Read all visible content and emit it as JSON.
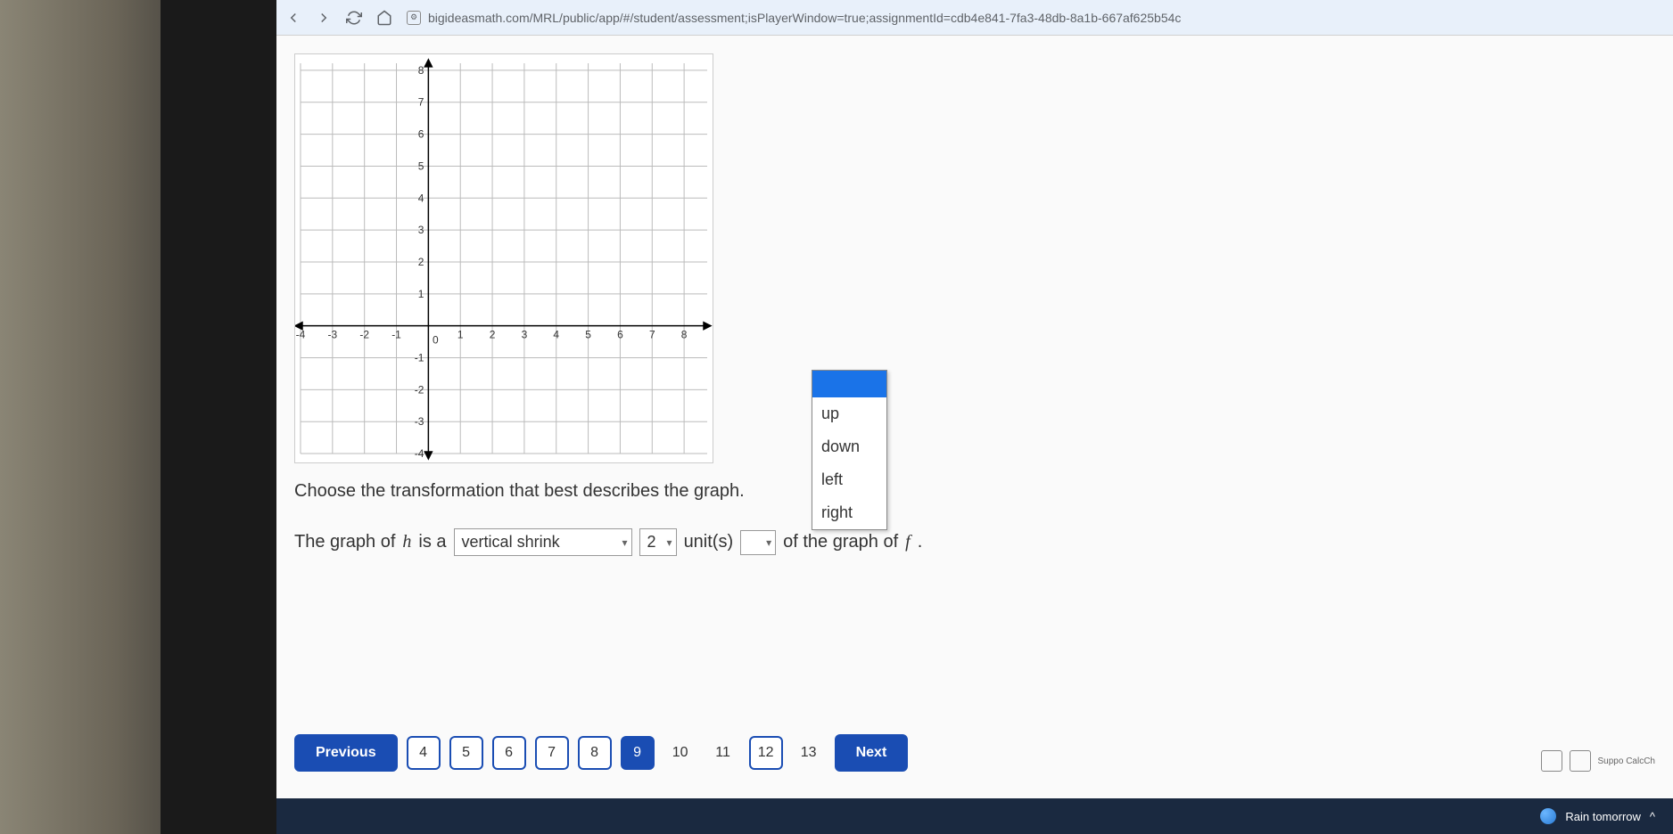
{
  "browser": {
    "url": "bigideasmath.com/MRL/public/app/#/student/assessment;isPlayerWindow=true;assignmentId=cdb4e841-7fa3-48db-8a1b-667af625b54c"
  },
  "graph": {
    "x_ticks": [
      "-4",
      "-3",
      "-2",
      "-1",
      "0",
      "1",
      "2",
      "3",
      "4",
      "5",
      "6",
      "7",
      "8"
    ],
    "y_ticks_pos": [
      "1",
      "2",
      "3",
      "4",
      "5",
      "6",
      "7",
      "8"
    ],
    "y_ticks_neg": [
      "-1",
      "-2",
      "-3",
      "-4"
    ]
  },
  "question": {
    "prompt": "Choose the transformation that best describes the graph.",
    "sentence_prefix": "The graph of ",
    "func_h": "h",
    "mid1": " is a ",
    "select1_value": "vertical shrink",
    "select2_value": "2",
    "units_label": " unit(s) ",
    "select3_value": "",
    "sentence_suffix": " of the graph of ",
    "func_f": "f",
    "period": " ."
  },
  "dropdown": {
    "options": [
      "",
      "up",
      "down",
      "left",
      "right"
    ]
  },
  "pagination": {
    "prev": "Previous",
    "next": "Next",
    "pages": [
      "4",
      "5",
      "6",
      "7",
      "8",
      "9",
      "10",
      "11",
      "12",
      "13"
    ],
    "current": "9"
  },
  "side": {
    "label": "Suppo\nCalcCh"
  },
  "taskbar": {
    "weather": "Rain tomorrow"
  }
}
